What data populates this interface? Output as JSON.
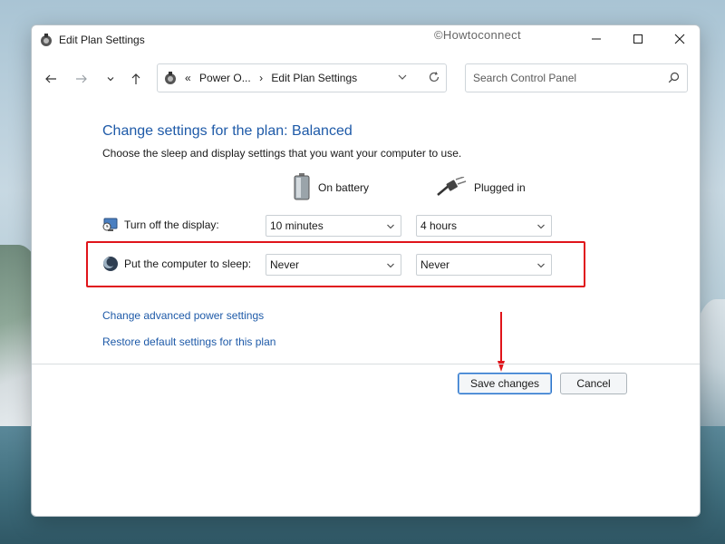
{
  "window": {
    "title": "Edit Plan Settings",
    "watermark": "©Howtoconnect"
  },
  "address": {
    "overflow": "«",
    "crumb_1": "Power O...",
    "separator": "›",
    "crumb_2": "Edit Plan Settings"
  },
  "search": {
    "placeholder": "Search Control Panel"
  },
  "main": {
    "heading": "Change settings for the plan: Balanced",
    "subtext": "Choose the sleep and display settings that you want your computer to use.",
    "columns": {
      "battery": "On battery",
      "plugged": "Plugged in"
    },
    "rows": [
      {
        "label": "Turn off the display:",
        "battery": "10 minutes",
        "plugged": "4 hours"
      },
      {
        "label": "Put the computer to sleep:",
        "battery": "Never",
        "plugged": "Never"
      }
    ],
    "links": {
      "advanced": "Change advanced power settings",
      "restore": "Restore default settings for this plan"
    }
  },
  "buttons": {
    "save": "Save changes",
    "cancel": "Cancel"
  },
  "colors": {
    "link": "#1e5aa8",
    "highlight": "#e0141a",
    "arrow": "#e0141a"
  }
}
